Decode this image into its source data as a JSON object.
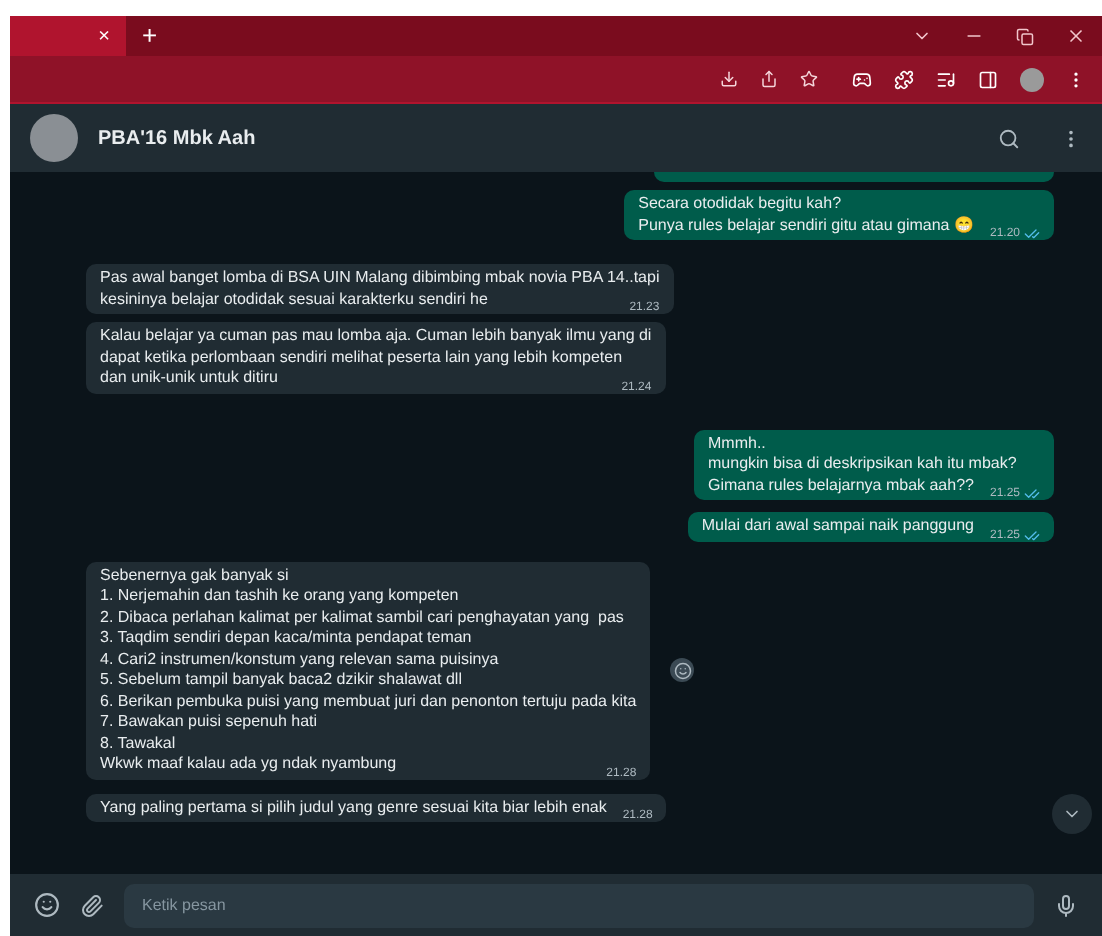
{
  "browser": {
    "tab_close": "×",
    "new_tab": "+"
  },
  "chat": {
    "title": "PBA'16 Mbk Aah"
  },
  "messages": [
    {
      "kind": "outgoing",
      "lines": [
        "Secara otodidak begitu kah?",
        "Punya rules belajar sendiri gitu atau gimana 😁"
      ],
      "time": "21.20",
      "read": true
    },
    {
      "kind": "incoming",
      "lines": [
        "Pas awal banget lomba di BSA UIN Malang dibimbing mbak novia PBA 14..tapi",
        "kesininya belajar otodidak sesuai karakterku sendiri he"
      ],
      "time": "21.23"
    },
    {
      "kind": "incoming",
      "lines": [
        "Kalau belajar ya cuman pas mau lomba aja. Cuman lebih banyak ilmu yang di",
        "dapat ketika perlombaan sendiri melihat peserta lain yang lebih kompeten",
        "dan unik-unik untuk ditiru"
      ],
      "time": "21.24"
    },
    {
      "kind": "outgoing",
      "lines": [
        "Mmmh..",
        "mungkin bisa di deskripsikan kah itu mbak?",
        "Gimana rules belajarnya mbak aah??"
      ],
      "time": "21.25",
      "read": true
    },
    {
      "kind": "outgoing",
      "lines": [
        "Mulai dari awal sampai naik panggung"
      ],
      "time": "21.25",
      "read": true
    },
    {
      "kind": "incoming",
      "react": true,
      "lines": [
        "Sebenernya gak banyak si",
        "1. Nerjemahin dan tashih ke orang yang kompeten",
        "2. Dibaca perlahan kalimat per kalimat sambil cari penghayatan yang  pas",
        "3. Taqdim sendiri depan kaca/minta pendapat teman",
        "4. Cari2 instrumen/konstum yang relevan sama puisinya",
        "5. Sebelum tampil banyak baca2 dzikir shalawat dll",
        "6. Berikan pembuka puisi yang membuat juri dan penonton tertuju pada kita",
        "7. Bawakan puisi sepenuh hati",
        "8. Tawakal",
        "Wkwk maaf kalau ada yg ndak nyambung"
      ],
      "time": "21.28"
    },
    {
      "kind": "incoming",
      "lines": [
        "Yang paling pertama si pilih judul yang genre sesuai kita biar lebih enak"
      ],
      "time": "21.28"
    }
  ],
  "composer": {
    "placeholder": "Ketik pesan"
  }
}
